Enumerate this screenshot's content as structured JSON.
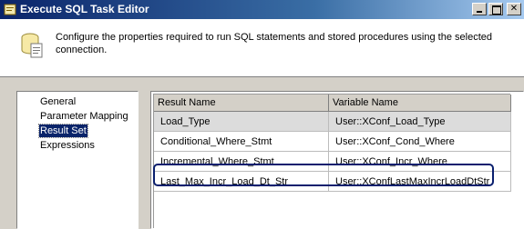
{
  "window": {
    "title": "Execute SQL Task Editor",
    "buttons": {
      "minimize": "",
      "maximize": "",
      "close": "✕"
    }
  },
  "header": {
    "description": "Configure the properties required to run SQL statements and stored procedures using the selected connection."
  },
  "nav": {
    "items": [
      {
        "label": "General",
        "selected": false
      },
      {
        "label": "Parameter Mapping",
        "selected": false
      },
      {
        "label": "Result Set",
        "selected": true
      },
      {
        "label": "Expressions",
        "selected": false
      }
    ]
  },
  "result_set": {
    "columns": [
      "Result Name",
      "Variable Name"
    ],
    "rows": [
      {
        "result_name": "Load_Type",
        "variable_name": "User::XConf_Load_Type"
      },
      {
        "result_name": "Conditional_Where_Stmt",
        "variable_name": "User::XConf_Cond_Where"
      },
      {
        "result_name": "Incremental_Where_Stmt",
        "variable_name": "User::XConf_Incr_Where"
      },
      {
        "result_name": "Last_Max_Incr_Load_Dt_Str",
        "variable_name": "User::XConfLastMaxIncrLoadDtStr"
      }
    ],
    "selected_row": 0,
    "highlighted_row": 3
  },
  "colors": {
    "title_bar": "#0a246a",
    "highlight_border": "#0a1f6e",
    "selection": "#0a246a"
  }
}
